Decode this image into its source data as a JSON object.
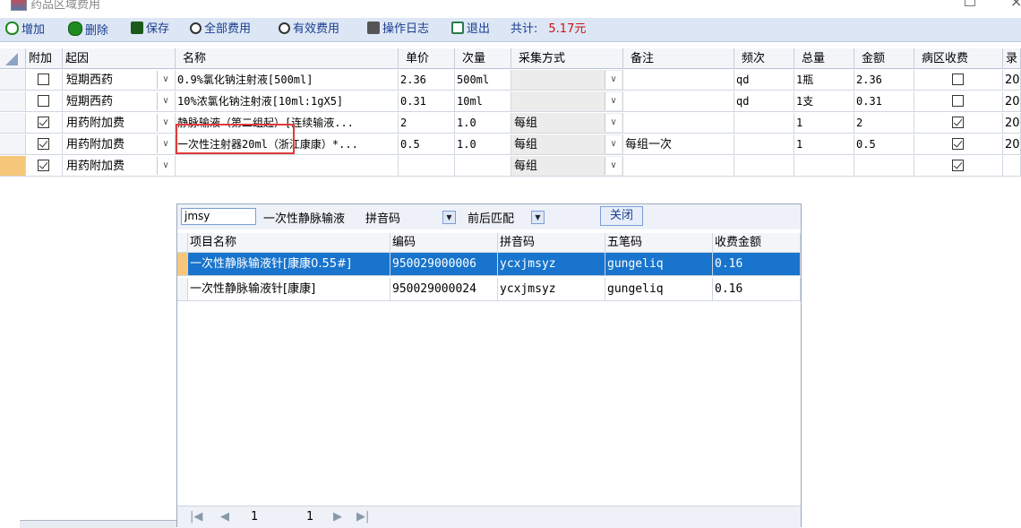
{
  "window": {
    "title": "药品区域费用"
  },
  "toolbar": {
    "add": "增加",
    "delete": "删除",
    "save": "保存",
    "all_fees": "全部费用",
    "valid_fees": "有效费用",
    "log": "操作日志",
    "exit": "退出",
    "total_label": "共计:",
    "total_value": "5.17元"
  },
  "grid": {
    "headers": [
      "附加",
      "起因",
      "名称",
      "单价",
      "次量",
      "采集方式",
      "备注",
      "频次",
      "总量",
      "金额",
      "病区收费",
      "录"
    ],
    "rows": [
      {
        "attached": false,
        "cause": "短期西药",
        "name": "0.9%氯化钠注射液[500ml]",
        "price": "2.36",
        "dose": "500ml",
        "method": "",
        "note": "",
        "freq": "qd",
        "qty": "1瓶",
        "amount": "2.36",
        "ward": false,
        "rec": "20"
      },
      {
        "attached": false,
        "cause": "短期西药",
        "name": "10%浓氯化钠注射液[10ml:1gX5]",
        "price": "0.31",
        "dose": "10ml",
        "method": "",
        "note": "",
        "freq": "qd",
        "qty": "1支",
        "amount": "0.31",
        "ward": false,
        "rec": "20"
      },
      {
        "attached": true,
        "cause": "用药附加费",
        "name": "静脉输液（第二组起）[连续输液...",
        "price": "2",
        "dose": "1.0",
        "method": "每组",
        "note": "",
        "freq": "",
        "qty": "1",
        "amount": "2",
        "ward": true,
        "rec": "20"
      },
      {
        "attached": true,
        "cause": "用药附加费",
        "name": "一次性注射器20ml（浙江康康）*...",
        "price": "0.5",
        "dose": "1.0",
        "method": "每组",
        "note": "每组一次",
        "freq": "",
        "qty": "1",
        "amount": "0.5",
        "ward": true,
        "rec": "20"
      },
      {
        "attached": true,
        "cause": "用药附加费",
        "name": "",
        "price": "",
        "dose": "",
        "method": "每组",
        "note": "",
        "freq": "",
        "qty": "",
        "amount": "",
        "ward": true,
        "rec": ""
      }
    ]
  },
  "popup": {
    "search_value": "jmsy",
    "hint_text": "一次性静脉输液",
    "mode": "拼音码",
    "match": "前后匹配",
    "close": "关闭",
    "headers": [
      "项目名称",
      "编码",
      "拼音码",
      "五笔码",
      "收费金额"
    ],
    "rows": [
      {
        "name": "一次性静脉输液针[康康0.55#]",
        "code": "950029000006",
        "pinyin": "ycxjmsyz",
        "wubi": "gungeliq",
        "fee": "0.16"
      },
      {
        "name": "一次性静脉输液针[康康]",
        "code": "950029000024",
        "pinyin": "ycxjmsyz",
        "wubi": "gungeliq",
        "fee": "0.16"
      }
    ],
    "pager": {
      "page": "1",
      "total": "1"
    }
  },
  "colors": {
    "selection": "#1874cd",
    "total_amount": "#d01010",
    "highlight_box": "#e03a3a",
    "toolbar_bg": "#dce6f4"
  }
}
